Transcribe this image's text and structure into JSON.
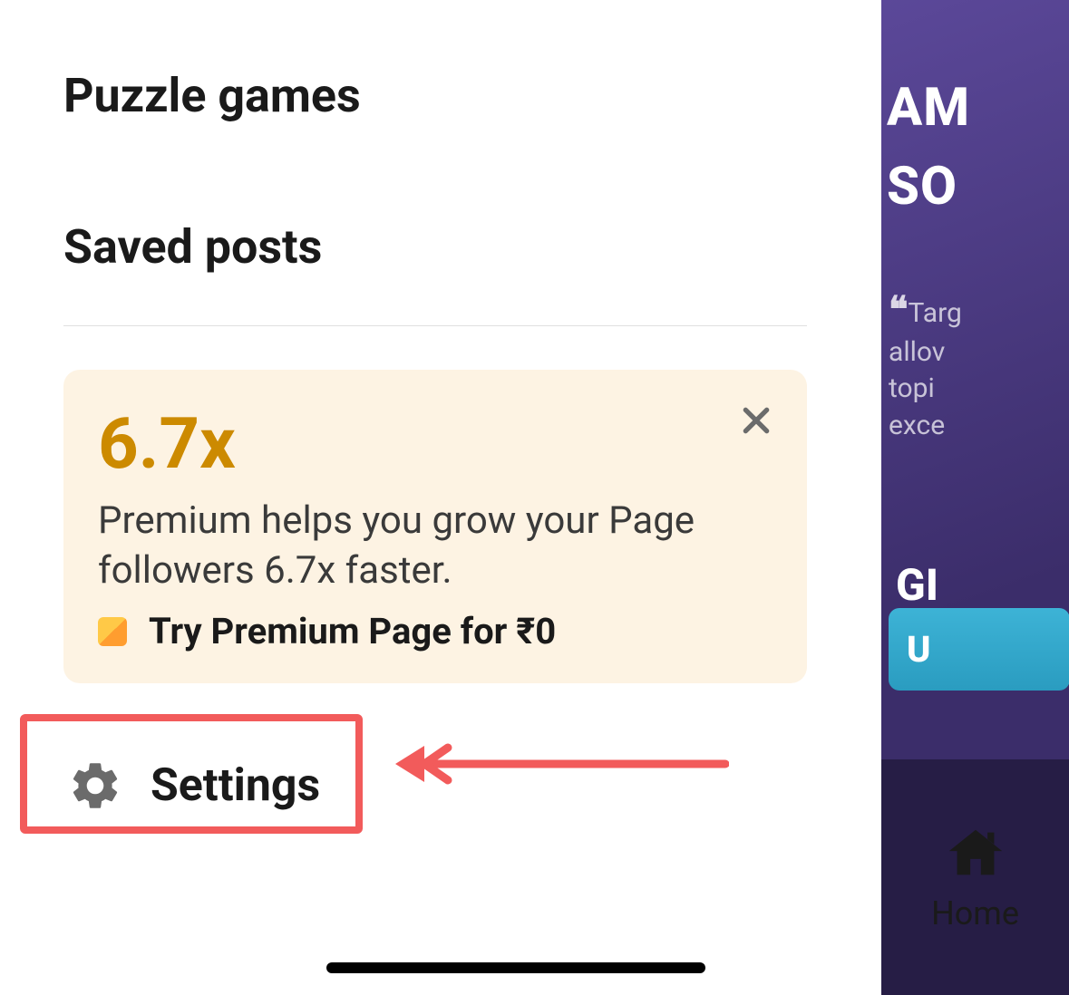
{
  "menu": {
    "items": [
      {
        "label": "Puzzle games"
      },
      {
        "label": "Saved posts"
      }
    ]
  },
  "promo": {
    "stat": "6.7x",
    "description": "Premium helps you grow your Page followers 6.7x faster.",
    "cta": "Try Premium Page for ₹0"
  },
  "settings": {
    "label": "Settings"
  },
  "side": {
    "heading_line1": "AM",
    "heading_line2": "SO",
    "quote_lines": [
      "Targ",
      "allov",
      "topi",
      "exce"
    ],
    "gi": "GI",
    "button": "U"
  },
  "nav": {
    "home": "Home"
  }
}
